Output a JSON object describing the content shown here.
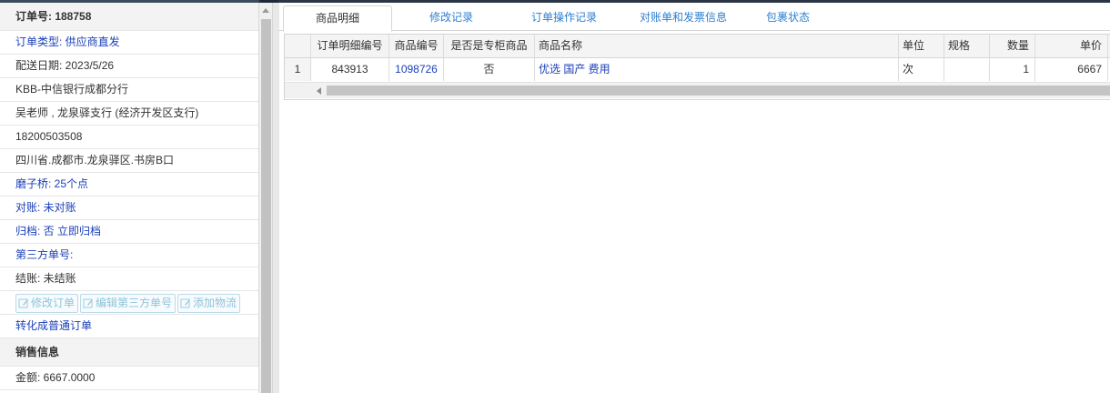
{
  "left_panel": {
    "order_no_label": "订单号: 188758",
    "rows": [
      {
        "text": "订单类型: 供应商直发",
        "style": "blue"
      },
      {
        "text": "配送日期: 2023/5/26",
        "style": "normal"
      },
      {
        "text": "KBB-中信银行成都分行",
        "style": "normal"
      },
      {
        "text": "吴老师 , 龙泉驿支行 (经济开发区支行)",
        "style": "normal"
      },
      {
        "text": "18200503508",
        "style": "normal"
      },
      {
        "text": "四川省.成都市.龙泉驿区.书房B口",
        "style": "normal"
      },
      {
        "text": "磨子桥: 25个点",
        "style": "blue"
      },
      {
        "text": "对账: 未对账",
        "style": "blue"
      },
      {
        "text": "归档:  否 立即归档",
        "style": "blue"
      },
      {
        "text": "第三方单号:",
        "style": "blue"
      },
      {
        "text": "结账: 未结账",
        "style": "normal"
      }
    ],
    "buttons": {
      "edit_order": "修改订单",
      "edit_third_party": "编辑第三方单号",
      "add_logistics": "添加物流"
    },
    "convert_link": "转化成普通订单",
    "sales_section_title": "销售信息",
    "amount": "金额: 6667.0000"
  },
  "tabs": [
    {
      "label": "商品明细",
      "active": true
    },
    {
      "label": "修改记录",
      "active": false
    },
    {
      "label": "订单操作记录",
      "active": false
    },
    {
      "label": "对账单和发票信息",
      "active": false
    },
    {
      "label": "包裹状态",
      "active": false
    }
  ],
  "table": {
    "columns": [
      "",
      "订单明细编号",
      "商品编号",
      "是否是专柜商品",
      "商品名称",
      "单位",
      "规格",
      "数量",
      "单价"
    ],
    "rows": [
      [
        "1",
        "843913",
        "1098726",
        "否",
        "优选 国产 费用",
        "次",
        "",
        "1",
        "6667"
      ]
    ]
  },
  "colors": {
    "link_blue": "#1a3fb8",
    "tab_blue": "#2f7fd0",
    "button_border": "#b9dbe8"
  }
}
